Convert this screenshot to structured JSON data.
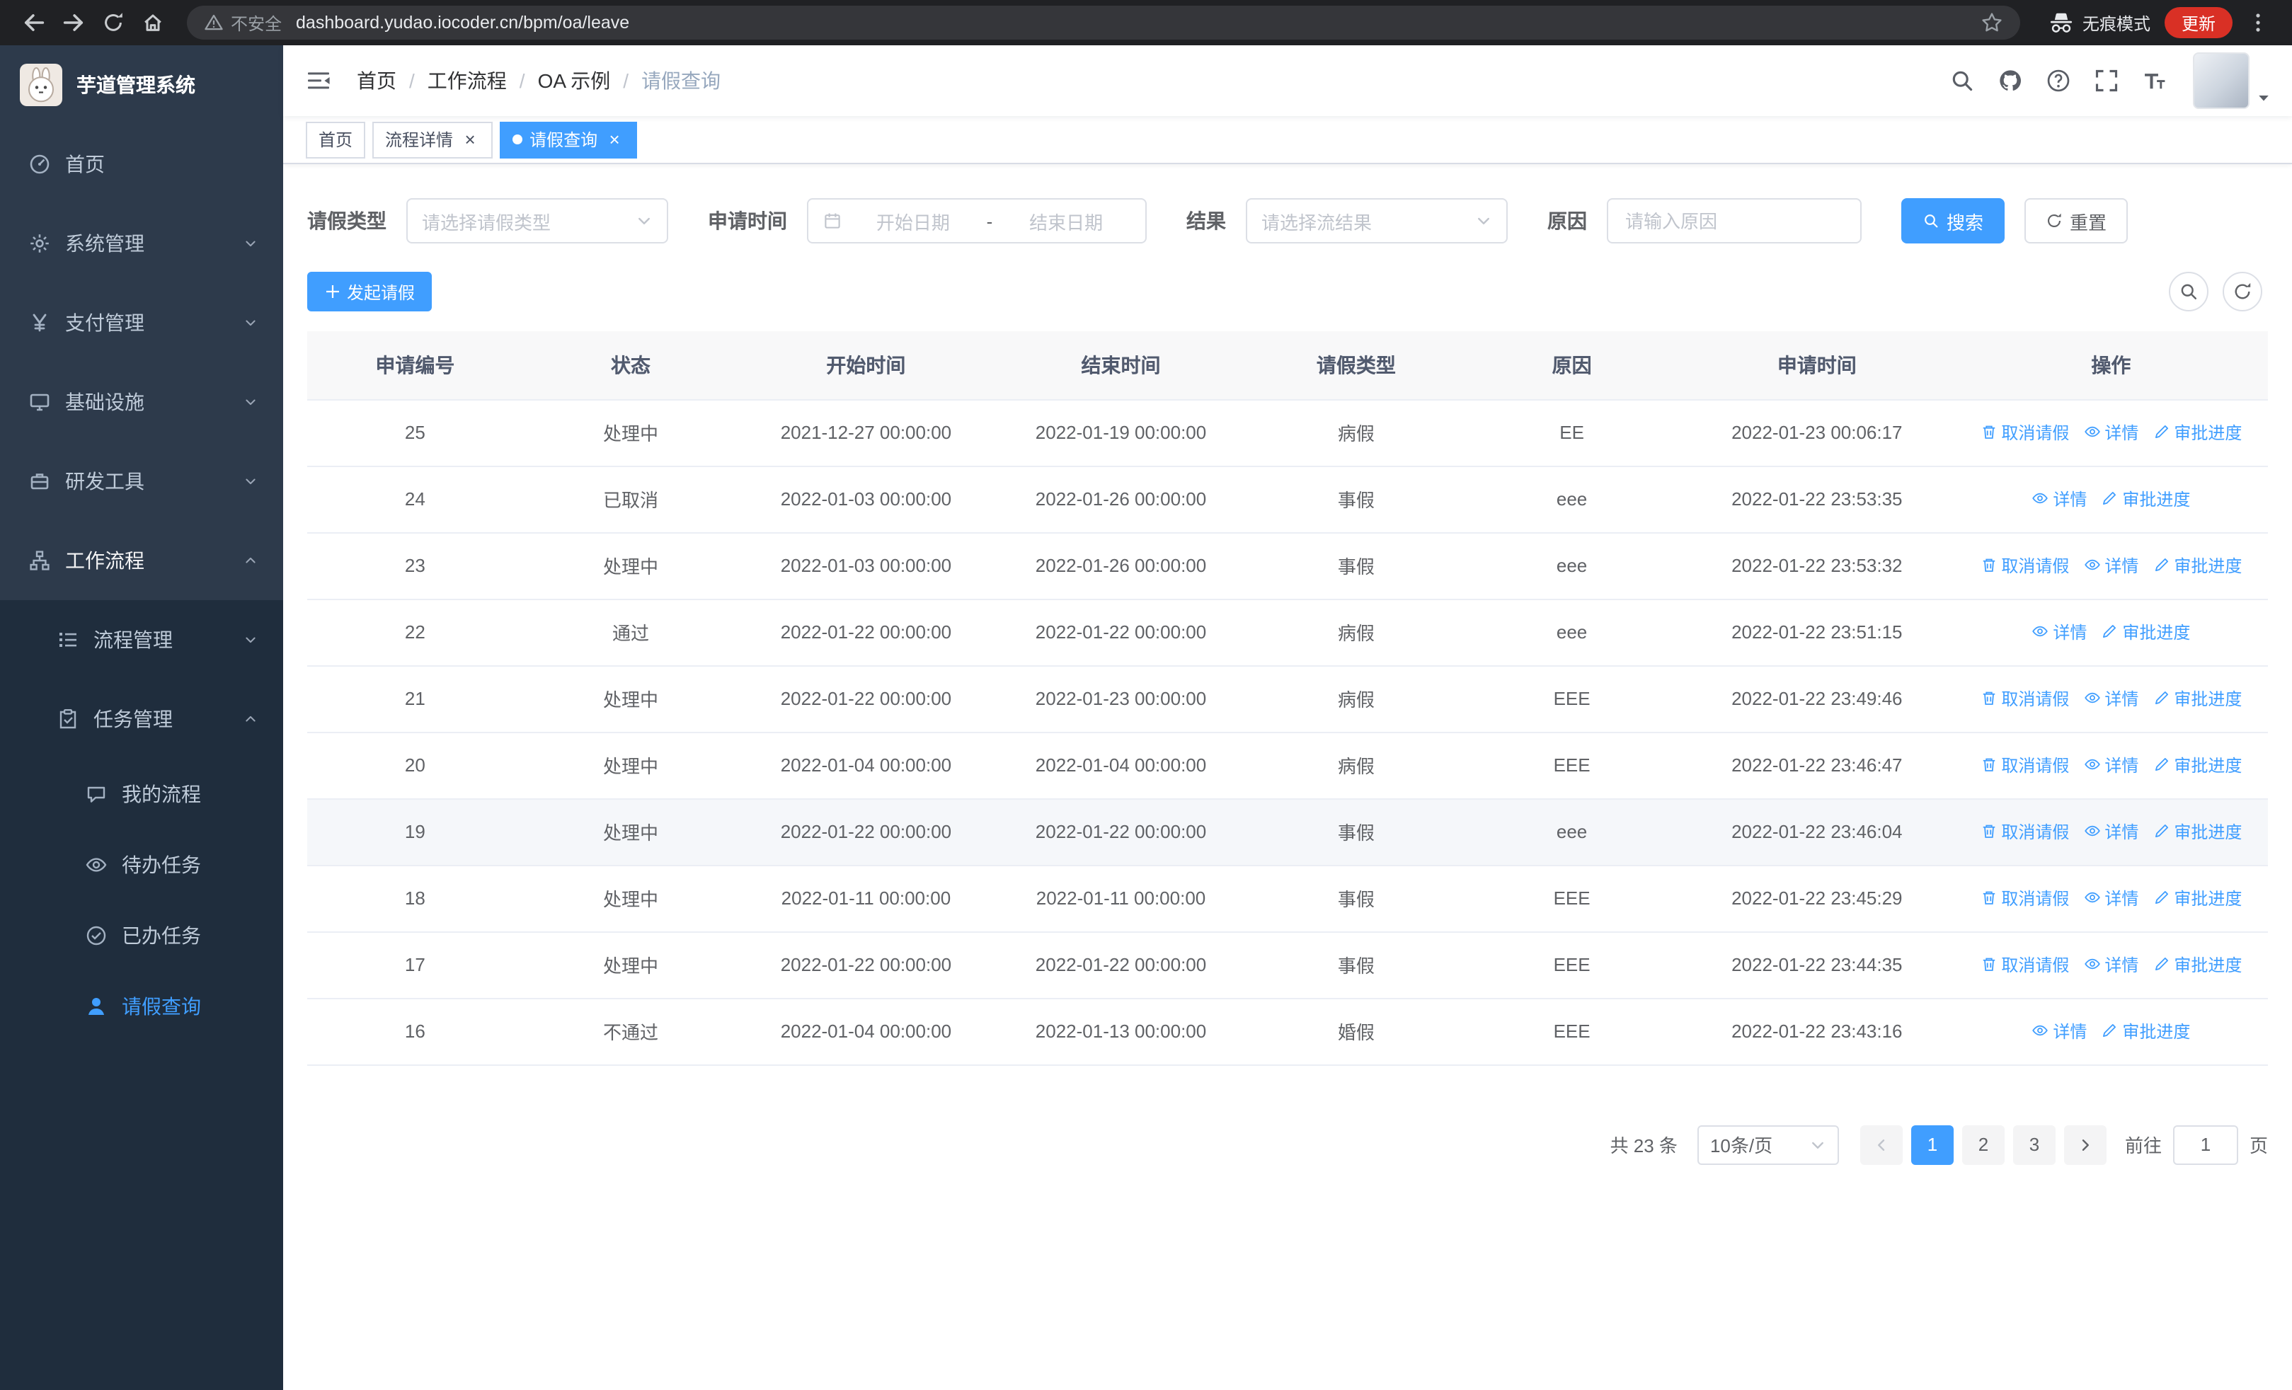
{
  "theme": {
    "primary": "#409eff",
    "sidebar_bg": "#2d3a4b",
    "submenu_bg": "#1f2d3d",
    "sidebar_text": "#bfcbd9",
    "browser_bar_bg": "#202124",
    "update_pill_bg": "#d93025",
    "link_color": "#409eff"
  },
  "browser": {
    "security_label": "不安全",
    "url": "dashboard.yudao.iocoder.cn/bpm/oa/leave",
    "incognito_label": "无痕模式",
    "update_label": "更新"
  },
  "sidebar": {
    "brand": "芋道管理系统",
    "items": [
      {
        "name": "home",
        "label": "首页",
        "icon": "dashboard-icon",
        "level": 1
      },
      {
        "name": "system-management",
        "label": "系统管理",
        "icon": "gear-icon",
        "level": 1,
        "chevron": "down"
      },
      {
        "name": "payment-management",
        "label": "支付管理",
        "icon": "payment-icon",
        "level": 1,
        "chevron": "down"
      },
      {
        "name": "infrastructure",
        "label": "基础设施",
        "icon": "infrastructure-icon",
        "level": 1,
        "chevron": "down"
      },
      {
        "name": "dev-tools",
        "label": "研发工具",
        "icon": "devtools-icon",
        "level": 1,
        "chevron": "down"
      },
      {
        "name": "workflow",
        "label": "工作流程",
        "icon": "workflow-icon",
        "level": 1,
        "chevron": "up",
        "bright": true
      },
      {
        "name": "process-management",
        "label": "流程管理",
        "icon": "process-icon",
        "level": 2,
        "chevron": "down"
      },
      {
        "name": "task-management",
        "label": "任务管理",
        "icon": "task-icon",
        "level": 2,
        "chevron": "up"
      },
      {
        "name": "my-process",
        "label": "我的流程",
        "icon": "my-process-icon",
        "level": 3
      },
      {
        "name": "todo-tasks",
        "label": "待办任务",
        "icon": "todo-icon",
        "level": 3
      },
      {
        "name": "done-tasks",
        "label": "已办任务",
        "icon": "done-icon",
        "level": 3
      },
      {
        "name": "leave-query",
        "label": "请假查询",
        "icon": "user-icon",
        "level": 3,
        "active": true
      }
    ]
  },
  "breadcrumb": {
    "items": [
      "首页",
      "工作流程",
      "OA 示例",
      "请假查询"
    ]
  },
  "tabs": {
    "items": [
      {
        "name": "home",
        "label": "首页",
        "closable": false,
        "active": false
      },
      {
        "name": "process-detail",
        "label": "流程详情",
        "closable": true,
        "active": false
      },
      {
        "name": "leave-query",
        "label": "请假查询",
        "closable": true,
        "active": true
      }
    ]
  },
  "filters": {
    "leave_type_label": "请假类型",
    "leave_type_placeholder": "请选择请假类型",
    "apply_time_label": "申请时间",
    "start_date_placeholder": "开始日期",
    "range_separator": "-",
    "end_date_placeholder": "结束日期",
    "result_label": "结果",
    "result_placeholder": "请选择流结果",
    "reason_label": "原因",
    "reason_placeholder": "请输入原因",
    "search_label": "搜索",
    "reset_label": "重置"
  },
  "toolbar": {
    "create_label": "发起请假"
  },
  "table": {
    "columns": [
      "申请编号",
      "状态",
      "开始时间",
      "结束时间",
      "请假类型",
      "原因",
      "申请时间",
      "操作"
    ],
    "action_labels": {
      "cancel": {
        "label": "取消请假",
        "icon": "delete-icon"
      },
      "detail": {
        "label": "详情",
        "icon": "view-icon"
      },
      "progress": {
        "label": "审批进度",
        "icon": "edit-icon"
      }
    },
    "rows": [
      {
        "id": "25",
        "status": "处理中",
        "start": "2021-12-27 00:00:00",
        "end": "2022-01-19 00:00:00",
        "type": "病假",
        "reason": "EE",
        "applied": "2022-01-23 00:06:17",
        "actions": [
          "cancel",
          "detail",
          "progress"
        ],
        "highlight": false
      },
      {
        "id": "24",
        "status": "已取消",
        "start": "2022-01-03 00:00:00",
        "end": "2022-01-26 00:00:00",
        "type": "事假",
        "reason": "eee",
        "applied": "2022-01-22 23:53:35",
        "actions": [
          "detail",
          "progress"
        ],
        "highlight": false
      },
      {
        "id": "23",
        "status": "处理中",
        "start": "2022-01-03 00:00:00",
        "end": "2022-01-26 00:00:00",
        "type": "事假",
        "reason": "eee",
        "applied": "2022-01-22 23:53:32",
        "actions": [
          "cancel",
          "detail",
          "progress"
        ],
        "highlight": false
      },
      {
        "id": "22",
        "status": "通过",
        "start": "2022-01-22 00:00:00",
        "end": "2022-01-22 00:00:00",
        "type": "病假",
        "reason": "eee",
        "applied": "2022-01-22 23:51:15",
        "actions": [
          "detail",
          "progress"
        ],
        "highlight": false
      },
      {
        "id": "21",
        "status": "处理中",
        "start": "2022-01-22 00:00:00",
        "end": "2022-01-23 00:00:00",
        "type": "病假",
        "reason": "EEE",
        "applied": "2022-01-22 23:49:46",
        "actions": [
          "cancel",
          "detail",
          "progress"
        ],
        "highlight": false
      },
      {
        "id": "20",
        "status": "处理中",
        "start": "2022-01-04 00:00:00",
        "end": "2022-01-04 00:00:00",
        "type": "病假",
        "reason": "EEE",
        "applied": "2022-01-22 23:46:47",
        "actions": [
          "cancel",
          "detail",
          "progress"
        ],
        "highlight": false
      },
      {
        "id": "19",
        "status": "处理中",
        "start": "2022-01-22 00:00:00",
        "end": "2022-01-22 00:00:00",
        "type": "事假",
        "reason": "eee",
        "applied": "2022-01-22 23:46:04",
        "actions": [
          "cancel",
          "detail",
          "progress"
        ],
        "highlight": true
      },
      {
        "id": "18",
        "status": "处理中",
        "start": "2022-01-11 00:00:00",
        "end": "2022-01-11 00:00:00",
        "type": "事假",
        "reason": "EEE",
        "applied": "2022-01-22 23:45:29",
        "actions": [
          "cancel",
          "detail",
          "progress"
        ],
        "highlight": false
      },
      {
        "id": "17",
        "status": "处理中",
        "start": "2022-01-22 00:00:00",
        "end": "2022-01-22 00:00:00",
        "type": "事假",
        "reason": "EEE",
        "applied": "2022-01-22 23:44:35",
        "actions": [
          "cancel",
          "detail",
          "progress"
        ],
        "highlight": false
      },
      {
        "id": "16",
        "status": "不通过",
        "start": "2022-01-04 00:00:00",
        "end": "2022-01-13 00:00:00",
        "type": "婚假",
        "reason": "EEE",
        "applied": "2022-01-22 23:43:16",
        "actions": [
          "detail",
          "progress"
        ],
        "highlight": false
      }
    ]
  },
  "pagination": {
    "total": "共 23 条",
    "page_size": "10条/页",
    "pages": [
      "1",
      "2",
      "3"
    ],
    "active_page": "1",
    "goto_label": "前往",
    "goto_value": "1",
    "page_unit": "页"
  }
}
